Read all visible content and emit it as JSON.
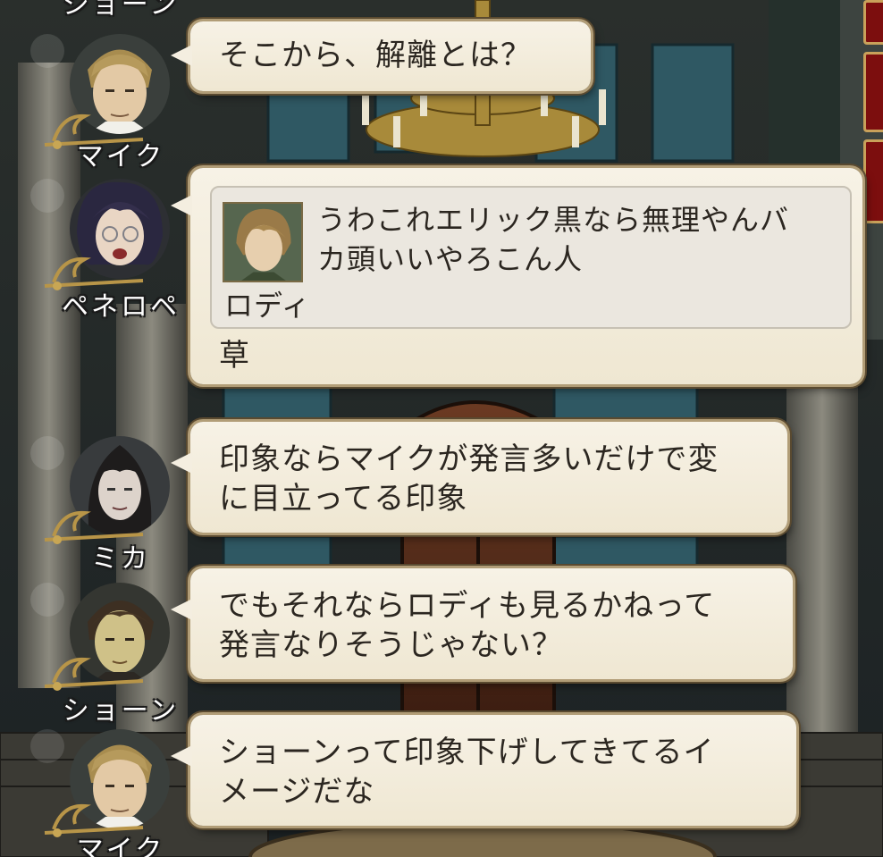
{
  "avatars": [
    {
      "name": "ショーン",
      "portrait": "sean-portrait"
    },
    {
      "name": "マイク",
      "portrait": "mike-portrait"
    },
    {
      "name": "ペネロペ",
      "portrait": "penelope-portrait"
    },
    {
      "name": "ミカ",
      "portrait": "mika-portrait"
    },
    {
      "name": "ショーン",
      "portrait": "sean-portrait"
    },
    {
      "name": "マイク",
      "portrait": "mike-portrait"
    }
  ],
  "messages": [
    {
      "speaker": "マイク",
      "text": "そこから、解離とは？"
    },
    {
      "speaker": "ペネロペ",
      "quote": {
        "name": "ロディ",
        "text": "うわこれエリック黒なら無理やんバ\nカ頭いいやろこん人"
      },
      "text": "草"
    },
    {
      "speaker": "ミカ",
      "text": "印象ならマイクが発言多いだけで変\nに目立ってる印象"
    },
    {
      "speaker": "ショーン",
      "text": "でもそれならロディも見るかねって\n発言なりそうじゃない？"
    },
    {
      "speaker": "マイク",
      "text": "ショーンって印象下げしてきてるイ\nメージだな"
    }
  ],
  "colors": {
    "bubble": "#f4eee0",
    "bubble_border": "#b19d77",
    "text": "#2b2620",
    "accent_red": "#7c0e0e"
  }
}
